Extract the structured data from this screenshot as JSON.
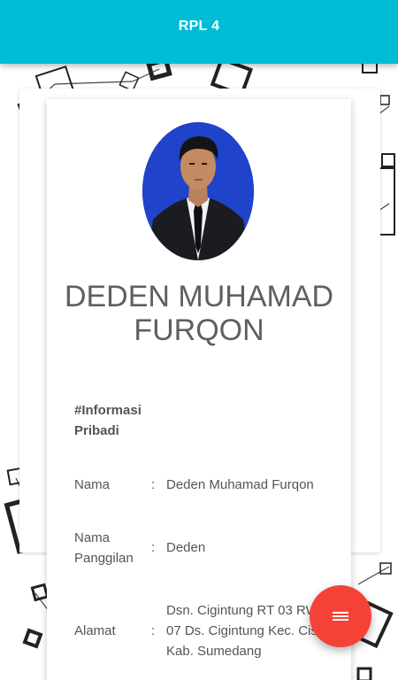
{
  "app_bar": {
    "title": "RPL 4"
  },
  "profile": {
    "photo_icon": "person-photo",
    "name": "DEDEN MUHAMAD FURQON"
  },
  "info": {
    "section_title": "#Informasi Pribadi",
    "rows": [
      {
        "label": "Nama",
        "value": "Deden Muhamad Furqon"
      },
      {
        "label": "Nama Panggilan",
        "value": "Deden"
      },
      {
        "label": "Alamat",
        "value": "Dsn. Cigintung RT 03 RW 07 Ds. Cigintung Kec. Cisitu Kab. Sumedang"
      }
    ],
    "separator": ":"
  },
  "fab": {
    "icon": "menu-icon"
  },
  "colors": {
    "app_bar": "#00bcd4",
    "fab": "#f44336",
    "photo_bg": "#1f43c9"
  }
}
